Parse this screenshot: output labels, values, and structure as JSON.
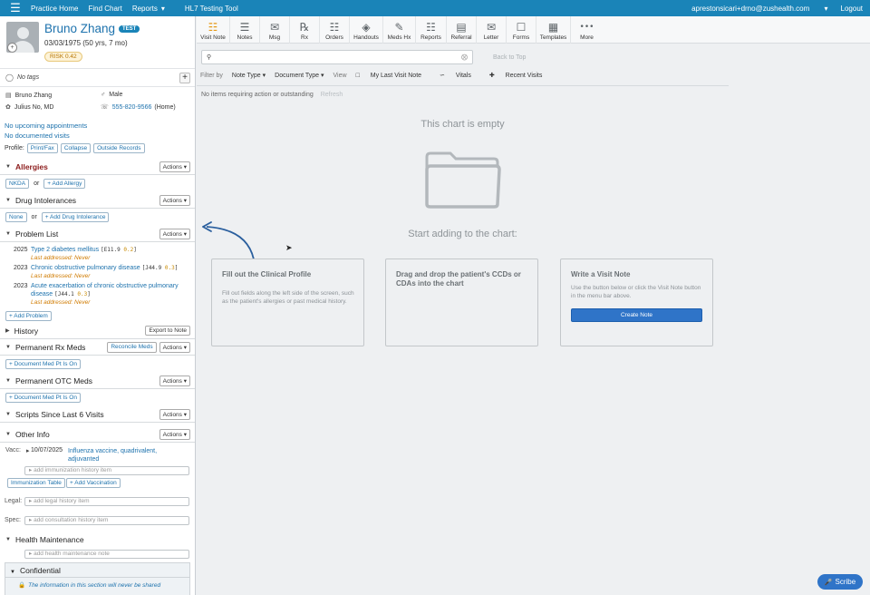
{
  "topbar": {
    "logo": "☰",
    "nav": [
      "Practice Home",
      "Find Chart",
      "Reports",
      "HL7 Testing Tool"
    ],
    "reports_caret": "▾",
    "user_email": "apreston­sicari+drno@zushealth.com",
    "user_caret": "▾",
    "logout": "Logout"
  },
  "patient": {
    "name": "Bruno Zhang",
    "test_badge": "TEST",
    "dob": "03/03/1975 (50 yrs, 7 mo)",
    "risk": "RISK 0.42",
    "tags": "No tags",
    "full_name": "Bruno Zhang",
    "sex": "Male",
    "provider": "Julius No, MD",
    "phone": "555-820-9566",
    "phone_type": "(Home)",
    "no_appointments": "No upcoming appointments",
    "no_visits": "No documented visits"
  },
  "profile": {
    "label": "Profile:",
    "buttons": [
      "Print/Fax",
      "Collapse",
      "Outside Records"
    ]
  },
  "sections": {
    "allergies": {
      "title": "Allergies",
      "actions": "Actions ▾",
      "nkda": "NKDA",
      "or": "or",
      "add": "+ Add Allergy"
    },
    "intolerances": {
      "title": "Drug Intolerances",
      "actions": "Actions ▾",
      "none": "None",
      "or": "or",
      "add": "+ Add Drug Intolerance"
    },
    "problems": {
      "title": "Problem List",
      "actions": "Actions ▾",
      "items": [
        {
          "year": "2025",
          "name": "Type 2 diabetes mellitus",
          "code": "E11.9",
          "score": "0.2",
          "last": "Last addressed: Never"
        },
        {
          "year": "2023",
          "name": "Chronic obstructive pulmonary disease",
          "code": "J44.9",
          "score": "0.3",
          "last": "Last addressed: Never"
        },
        {
          "year": "2023",
          "name": "Acute exacerbation of chronic obstructive pulmonary disease",
          "code": "J44.1",
          "score": "0.3",
          "last": "Last addressed: Never"
        }
      ],
      "add": "+ Add Problem"
    },
    "history": {
      "title": "History",
      "export": "Export to Note"
    },
    "rx_meds": {
      "title": "Permanent Rx Meds",
      "reconcile": "Reconcile Meds",
      "actions": "Actions ▾",
      "add": "+ Document Med Pt Is On"
    },
    "otc_meds": {
      "title": "Permanent OTC Meds",
      "actions": "Actions ▾",
      "add": "+ Document Med Pt Is On"
    },
    "scripts": {
      "title": "Scripts Since Last 6 Visits",
      "actions": "Actions ▾"
    },
    "other": {
      "title": "Other Info",
      "actions": "Actions ▾",
      "vacc_label": "Vacc:",
      "vacc_date": "10/07/2025",
      "vacc_name": "Influenza vaccine, quadrivalent, adjuvanted",
      "immunization_placeholder": "add immunization history item",
      "immunization_table": "Immunization Table",
      "add_vaccination": "+ Add Vaccination",
      "legal_label": "Legal:",
      "legal_placeholder": "add legal history item",
      "spec_label": "Spec:",
      "spec_placeholder": "add consultation history item"
    },
    "health_maintenance": {
      "title": "Health Maintenance",
      "placeholder": "add health maintenance note"
    },
    "confidential": {
      "title": "Confidential",
      "note": "The information in this section will never be shared"
    }
  },
  "toolbar": [
    {
      "label": "Visit Note",
      "icon": "visit-note-icon",
      "glyph": "☷"
    },
    {
      "label": "Notes",
      "icon": "notes-icon",
      "glyph": "☰"
    },
    {
      "label": "Msg",
      "icon": "message-icon",
      "glyph": "✉"
    },
    {
      "label": "Rx",
      "icon": "rx-icon",
      "glyph": "℞"
    },
    {
      "label": "Orders",
      "icon": "orders-icon",
      "glyph": "☷"
    },
    {
      "label": "Handouts",
      "icon": "handouts-icon",
      "glyph": "◈"
    },
    {
      "label": "Meds Hx",
      "icon": "meds-hx-icon",
      "glyph": "✎"
    },
    {
      "label": "Reports",
      "icon": "reports-icon",
      "glyph": "☷"
    },
    {
      "label": "Referral",
      "icon": "referral-icon",
      "glyph": "▤"
    },
    {
      "label": "Letter",
      "icon": "letter-icon",
      "glyph": "✉"
    },
    {
      "label": "Forms",
      "icon": "forms-icon",
      "glyph": "☐"
    },
    {
      "label": "Templates",
      "icon": "templates-icon",
      "glyph": "▦"
    },
    {
      "label": "More",
      "icon": "more-icon",
      "glyph": "•••"
    }
  ],
  "search": {
    "placeholder": ""
  },
  "back_to_top": "Back to Top",
  "filters": {
    "filter_by": "Filter by",
    "note_type": "Note Type ▾",
    "document_type": "Document Type ▾",
    "view": "View",
    "last_visit": "My Last Visit Note",
    "vitals": "Vitals",
    "recent_visits": "Recent Visits"
  },
  "main": {
    "no_items": "No items requiring action or outstanding",
    "refresh": "Refresh",
    "empty_title": "This chart is empty",
    "start_title": "Start adding to the chart:",
    "cards": [
      {
        "title": "Fill out the Clinical Profile",
        "body": "Fill out fields along the left side of the screen, such as the patient's allergies or past medical history."
      },
      {
        "title": "Drag and drop the patient's CCDs or CDAs into the chart",
        "body": ""
      },
      {
        "title": "Write a Visit Note",
        "body": "Use the button below or click the Visit Note button in the menu bar above.",
        "button": "Create Note"
      }
    ]
  },
  "scribe": "Scribe",
  "colors": {
    "brand": "#1a84b8",
    "link": "#1d72ad",
    "primary_button": "#2f74c8"
  }
}
